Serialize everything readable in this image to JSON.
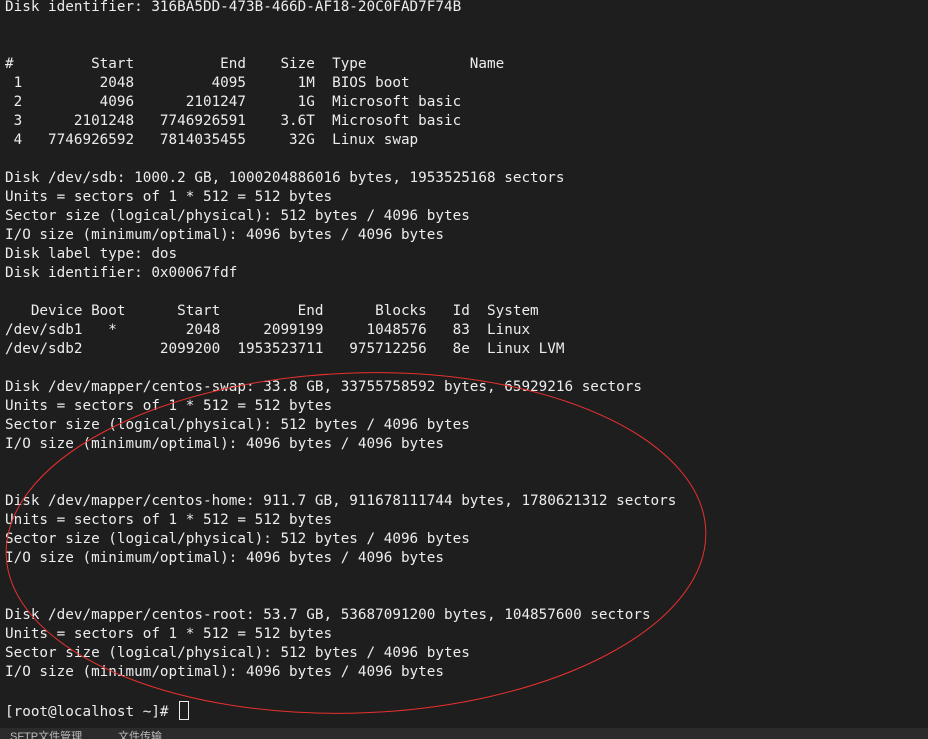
{
  "terminal": {
    "lines": [
      "Disk identifier: 316BA5DD-473B-466D-AF18-20C0FAD7F74B",
      "",
      "",
      "#         Start          End    Size  Type            Name",
      " 1         2048         4095      1M  BIOS boot",
      " 2         4096      2101247      1G  Microsoft basic",
      " 3      2101248   7746926591    3.6T  Microsoft basic",
      " 4   7746926592   7814035455     32G  Linux swap",
      "",
      "Disk /dev/sdb: 1000.2 GB, 1000204886016 bytes, 1953525168 sectors",
      "Units = sectors of 1 * 512 = 512 bytes",
      "Sector size (logical/physical): 512 bytes / 4096 bytes",
      "I/O size (minimum/optimal): 4096 bytes / 4096 bytes",
      "Disk label type: dos",
      "Disk identifier: 0x00067fdf",
      "",
      "   Device Boot      Start         End      Blocks   Id  System",
      "/dev/sdb1   *        2048     2099199     1048576   83  Linux",
      "/dev/sdb2         2099200  1953523711   975712256   8e  Linux LVM",
      "",
      "Disk /dev/mapper/centos-swap: 33.8 GB, 33755758592 bytes, 65929216 sectors",
      "Units = sectors of 1 * 512 = 512 bytes",
      "Sector size (logical/physical): 512 bytes / 4096 bytes",
      "I/O size (minimum/optimal): 4096 bytes / 4096 bytes",
      "",
      "",
      "Disk /dev/mapper/centos-home: 911.7 GB, 911678111744 bytes, 1780621312 sectors",
      "Units = sectors of 1 * 512 = 512 bytes",
      "Sector size (logical/physical): 512 bytes / 4096 bytes",
      "I/O size (minimum/optimal): 4096 bytes / 4096 bytes",
      "",
      "",
      "Disk /dev/mapper/centos-root: 53.7 GB, 53687091200 bytes, 104857600 sectors",
      "Units = sectors of 1 * 512 = 512 bytes",
      "Sector size (logical/physical): 512 bytes / 4096 bytes",
      "I/O size (minimum/optimal): 4096 bytes / 4096 bytes",
      ""
    ],
    "prompt": "[root@localhost ~]# "
  },
  "bottom_bar": {
    "tabs": [
      "SFTP文件管理",
      "文件传输"
    ]
  },
  "colors": {
    "background": "#1e1e1e",
    "text": "#ececec",
    "annotation": "#e8312f"
  },
  "icons": {
    "annotation": "red-ellipse-annotation"
  }
}
